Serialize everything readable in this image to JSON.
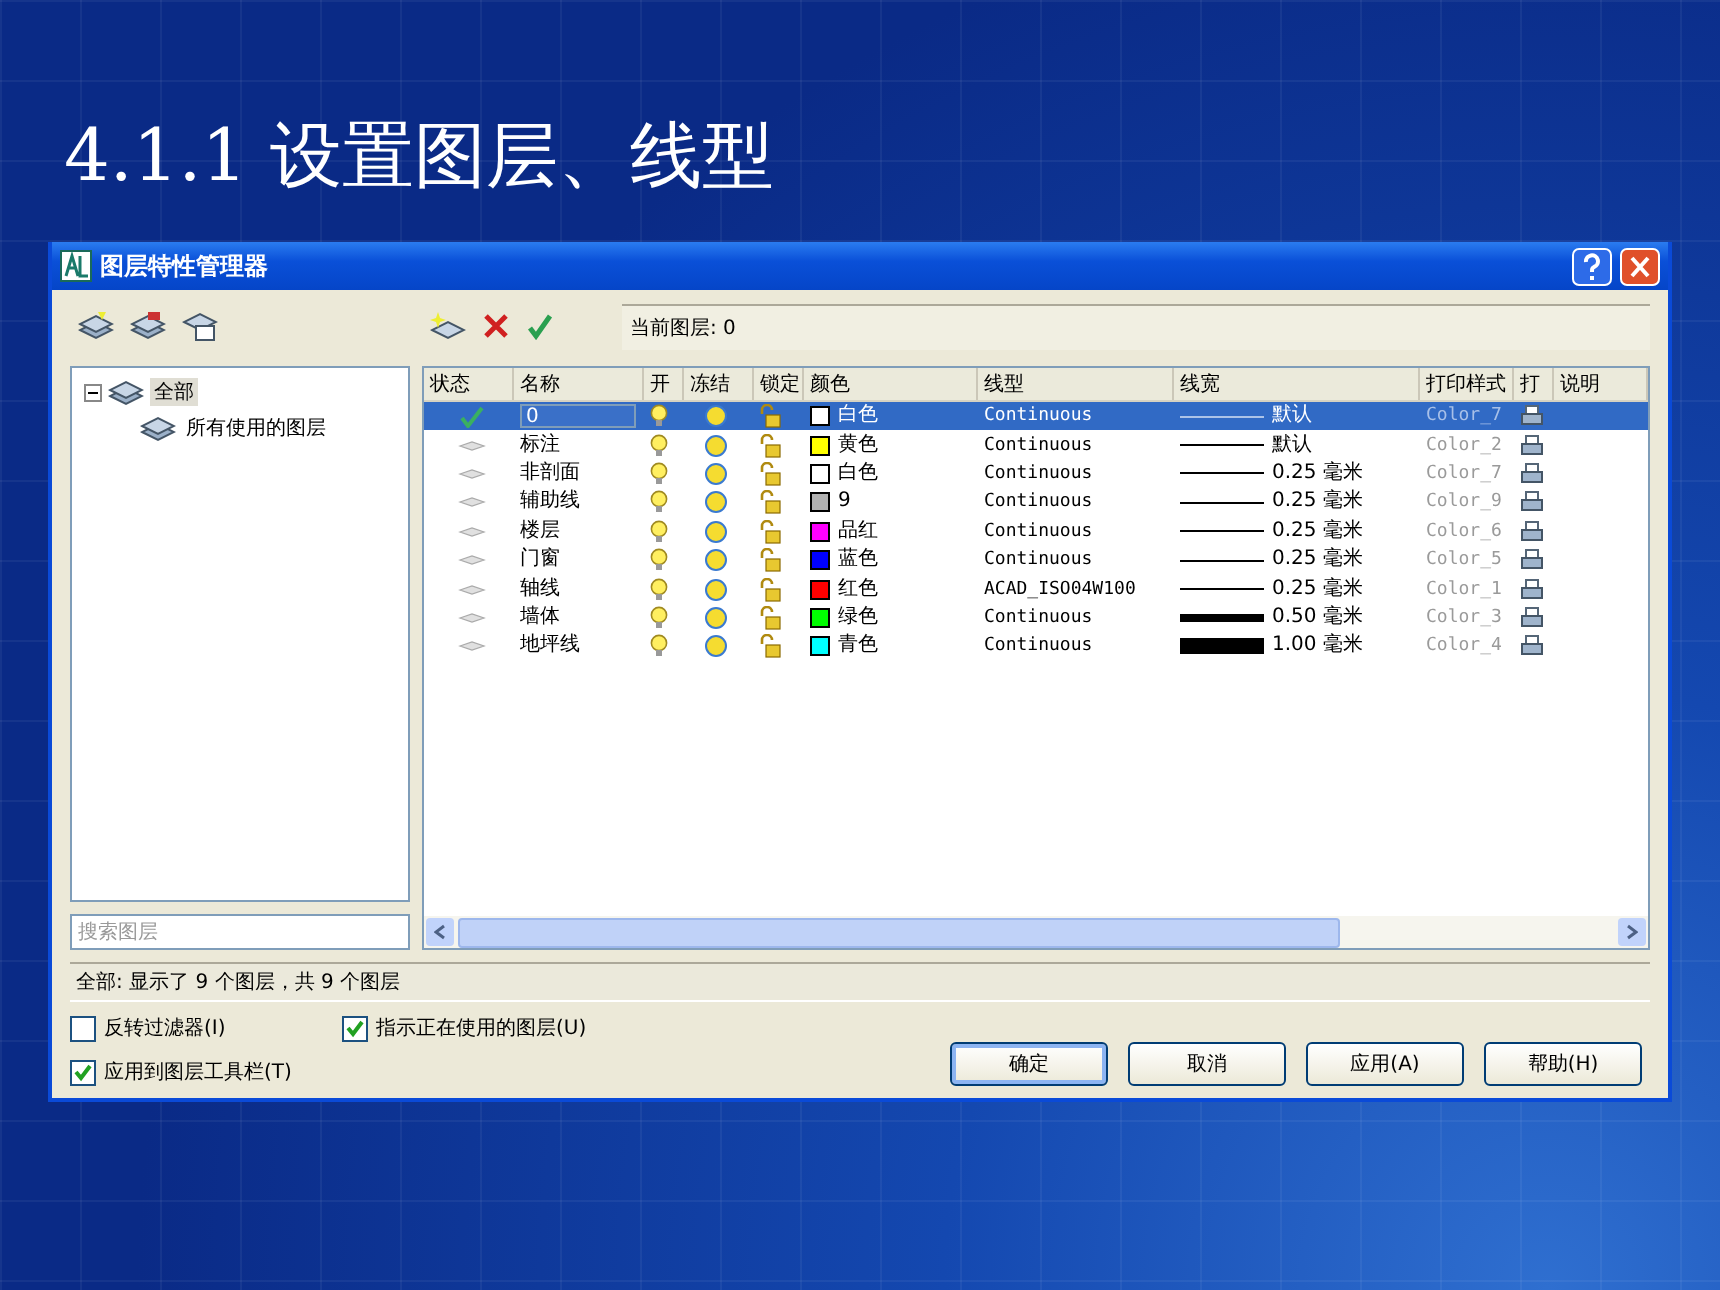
{
  "slide_title": "4.1.1 设置图层、线型",
  "dialog": {
    "title": "图层特性管理器",
    "current_layer": "当前图层: 0",
    "tree": [
      {
        "label": "全部",
        "selected": true,
        "expanded": true,
        "children": [
          {
            "label": "所有使用的图层",
            "selected": false
          }
        ]
      }
    ],
    "search": {
      "placeholder": "搜索图层"
    },
    "table": {
      "columns": [
        "状态",
        "名称",
        "开",
        "冻结",
        "锁定",
        "颜色",
        "线型",
        "线宽",
        "打印样式",
        "打",
        "说明"
      ],
      "rows": [
        {
          "current": true,
          "name": "0",
          "editing": true,
          "selected": true,
          "on": true,
          "frozen": false,
          "locked": false,
          "color": "#ffffff",
          "color_name": "白色",
          "linetype": "Continuous",
          "lineweight": {
            "kind": "thin",
            "text": "默认"
          },
          "plot_style": "Color_7",
          "plot": true
        },
        {
          "current": false,
          "name": "标注",
          "editing": false,
          "selected": false,
          "on": true,
          "frozen": false,
          "locked": false,
          "color": "#ffff00",
          "color_name": "黄色",
          "linetype": "Continuous",
          "lineweight": {
            "kind": "thin",
            "text": "默认"
          },
          "plot_style": "Color_2",
          "plot": true
        },
        {
          "current": false,
          "name": "非剖面",
          "editing": false,
          "selected": false,
          "on": true,
          "frozen": false,
          "locked": false,
          "color": "#ffffff",
          "color_name": "白色",
          "linetype": "Continuous",
          "lineweight": {
            "kind": "thin",
            "text": "0.25 毫米"
          },
          "plot_style": "Color_7",
          "plot": true
        },
        {
          "current": false,
          "name": "辅助线",
          "editing": false,
          "selected": false,
          "on": true,
          "frozen": false,
          "locked": false,
          "color": "#b0b0b0",
          "color_name": "9",
          "linetype": "Continuous",
          "lineweight": {
            "kind": "thin",
            "text": "0.25 毫米"
          },
          "plot_style": "Color_9",
          "plot": true
        },
        {
          "current": false,
          "name": "楼层",
          "editing": false,
          "selected": false,
          "on": true,
          "frozen": false,
          "locked": false,
          "color": "#ff00ff",
          "color_name": "品红",
          "linetype": "Continuous",
          "lineweight": {
            "kind": "thin",
            "text": "0.25 毫米"
          },
          "plot_style": "Color_6",
          "plot": true
        },
        {
          "current": false,
          "name": "门窗",
          "editing": false,
          "selected": false,
          "on": true,
          "frozen": false,
          "locked": false,
          "color": "#0000ff",
          "color_name": "蓝色",
          "linetype": "Continuous",
          "lineweight": {
            "kind": "thin",
            "text": "0.25 毫米"
          },
          "plot_style": "Color_5",
          "plot": true
        },
        {
          "current": false,
          "name": "轴线",
          "editing": false,
          "selected": false,
          "on": true,
          "frozen": false,
          "locked": false,
          "color": "#ff0000",
          "color_name": "红色",
          "linetype": "ACAD_ISO04W100",
          "lineweight": {
            "kind": "thin",
            "text": "0.25 毫米"
          },
          "plot_style": "Color_1",
          "plot": true
        },
        {
          "current": false,
          "name": "墙体",
          "editing": false,
          "selected": false,
          "on": true,
          "frozen": false,
          "locked": false,
          "color": "#00ff00",
          "color_name": "绿色",
          "linetype": "Continuous",
          "lineweight": {
            "kind": "bold",
            "text": "0.50 毫米"
          },
          "plot_style": "Color_3",
          "plot": true
        },
        {
          "current": false,
          "name": "地坪线",
          "editing": false,
          "selected": false,
          "on": true,
          "frozen": false,
          "locked": false,
          "color": "#00ffff",
          "color_name": "青色",
          "linetype": "Continuous",
          "lineweight": {
            "kind": "heavy",
            "text": "1.00 毫米"
          },
          "plot_style": "Color_4",
          "plot": true
        }
      ]
    },
    "status_bar": "全部: 显示了 9 个图层，共 9 个图层",
    "options": [
      {
        "label": "反转过滤器(I)",
        "checked": false
      },
      {
        "label": "指示正在使用的图层(U)",
        "checked": true
      },
      {
        "label": "应用到图层工具栏(T)",
        "checked": true
      }
    ],
    "buttons": [
      {
        "label": "确定",
        "default": true
      },
      {
        "label": "取消",
        "default": false
      },
      {
        "label": "应用(A)",
        "default": false
      },
      {
        "label": "帮助(H)",
        "default": false
      }
    ]
  }
}
